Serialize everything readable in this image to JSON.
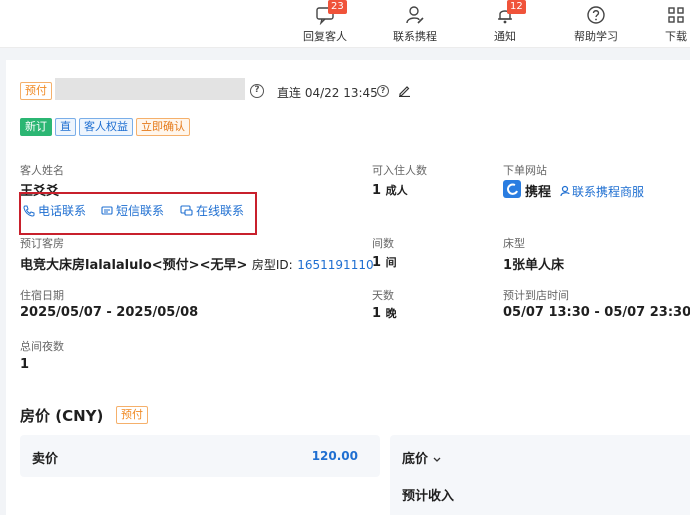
{
  "topnav": {
    "items": [
      {
        "label": "回复客人",
        "badge": "23",
        "icon": "chat-icon"
      },
      {
        "label": "联系携程",
        "badge": "",
        "icon": "person-edit-icon"
      },
      {
        "label": "通知",
        "badge": "12",
        "icon": "bell-icon"
      },
      {
        "label": "帮助学习",
        "badge": "",
        "icon": "help-circle-icon"
      },
      {
        "label": "下载",
        "badge": "",
        "icon": "grid-icon"
      }
    ]
  },
  "order": {
    "pay_tag": "预付",
    "connection": "直连 04/22 13:45",
    "tags": [
      "新订",
      "直",
      "客人权益",
      "立即确认"
    ]
  },
  "guest": {
    "name_label": "客人姓名",
    "name_value": "王爻爻",
    "contacts": [
      "电话联系",
      "短信联系",
      "在线联系"
    ]
  },
  "occupancy": {
    "label": "可入住人数",
    "value": "1",
    "unit": "成人"
  },
  "channel": {
    "label": "下单网站",
    "site": "携程",
    "service_link": "联系携程商服"
  },
  "room": {
    "label": "预订客房",
    "value": "电竞大床房lalalalulo<预付><无早>",
    "id_label": "房型ID:",
    "id_value": "1651191110"
  },
  "rooms_count": {
    "label": "间数",
    "value": "1",
    "unit": "间"
  },
  "bed": {
    "label": "床型",
    "value": "1张单人床"
  },
  "stay": {
    "label": "住宿日期",
    "value": "2025/05/07 - 2025/05/08"
  },
  "days": {
    "label": "天数",
    "value": "1",
    "unit": "晚"
  },
  "arrival": {
    "label": "预计到店时间",
    "value": "05/07 13:30 - 05/07 23:30"
  },
  "nights": {
    "label": "总间夜数",
    "value": "1"
  },
  "pricing": {
    "title": "房价 (CNY)",
    "tag": "预付",
    "sell_label": "卖价",
    "sell_value": "120.00",
    "base_label": "底价",
    "expected_label": "预计收入"
  },
  "colors": {
    "accent": "#1f6fd1",
    "badge": "#f0533a",
    "highlight_box": "#c8202c",
    "tag_orange": "#f08a24",
    "tag_green": "#2bb673"
  }
}
